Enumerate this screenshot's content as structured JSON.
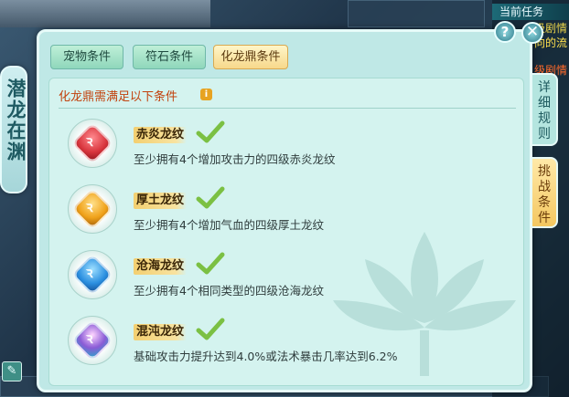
{
  "side_title": "潜龙在渊",
  "tabs": [
    {
      "label": "宠物条件",
      "active": false
    },
    {
      "label": "符石条件",
      "active": false
    },
    {
      "label": "化龙鼎条件",
      "active": true
    }
  ],
  "content_title": "化龙鼎需满足以下条件",
  "requirements": [
    {
      "name": "赤炎龙纹",
      "desc": "至少拥有4个增加攻击力的四级赤炎龙纹",
      "gem_color": "#d9363e",
      "met": true
    },
    {
      "name": "厚土龙纹",
      "desc": "至少拥有4个增加气血的四级厚土龙纹",
      "gem_color": "#f0a21a",
      "met": true
    },
    {
      "name": "沧海龙纹",
      "desc": "至少拥有4个相同类型的四级沧海龙纹",
      "gem_color": "#2b8fe0",
      "met": true
    },
    {
      "name": "混沌龙纹",
      "desc": "基础攻击力提升达到4.0%或法术暴击几率达到6.2%",
      "gem_color": "#8a5bd6",
      "met": true
    }
  ],
  "side_tabs": {
    "rules": "详细规则",
    "challenge": "挑战条件"
  },
  "quest": {
    "header": "当前任务",
    "lines": [
      {
        "text": "级剧情",
        "color": "#e9d34a"
      },
      {
        "text": "向的流",
        "color": "#ffe14d"
      },
      {
        "text": "级剧情",
        "color": "#ff6a2a"
      }
    ]
  },
  "icons": {
    "help": "?",
    "close": "✕",
    "info": "i",
    "edit": "✎"
  },
  "colors": {
    "accent": "#c2410c",
    "check": "#7bc043"
  }
}
